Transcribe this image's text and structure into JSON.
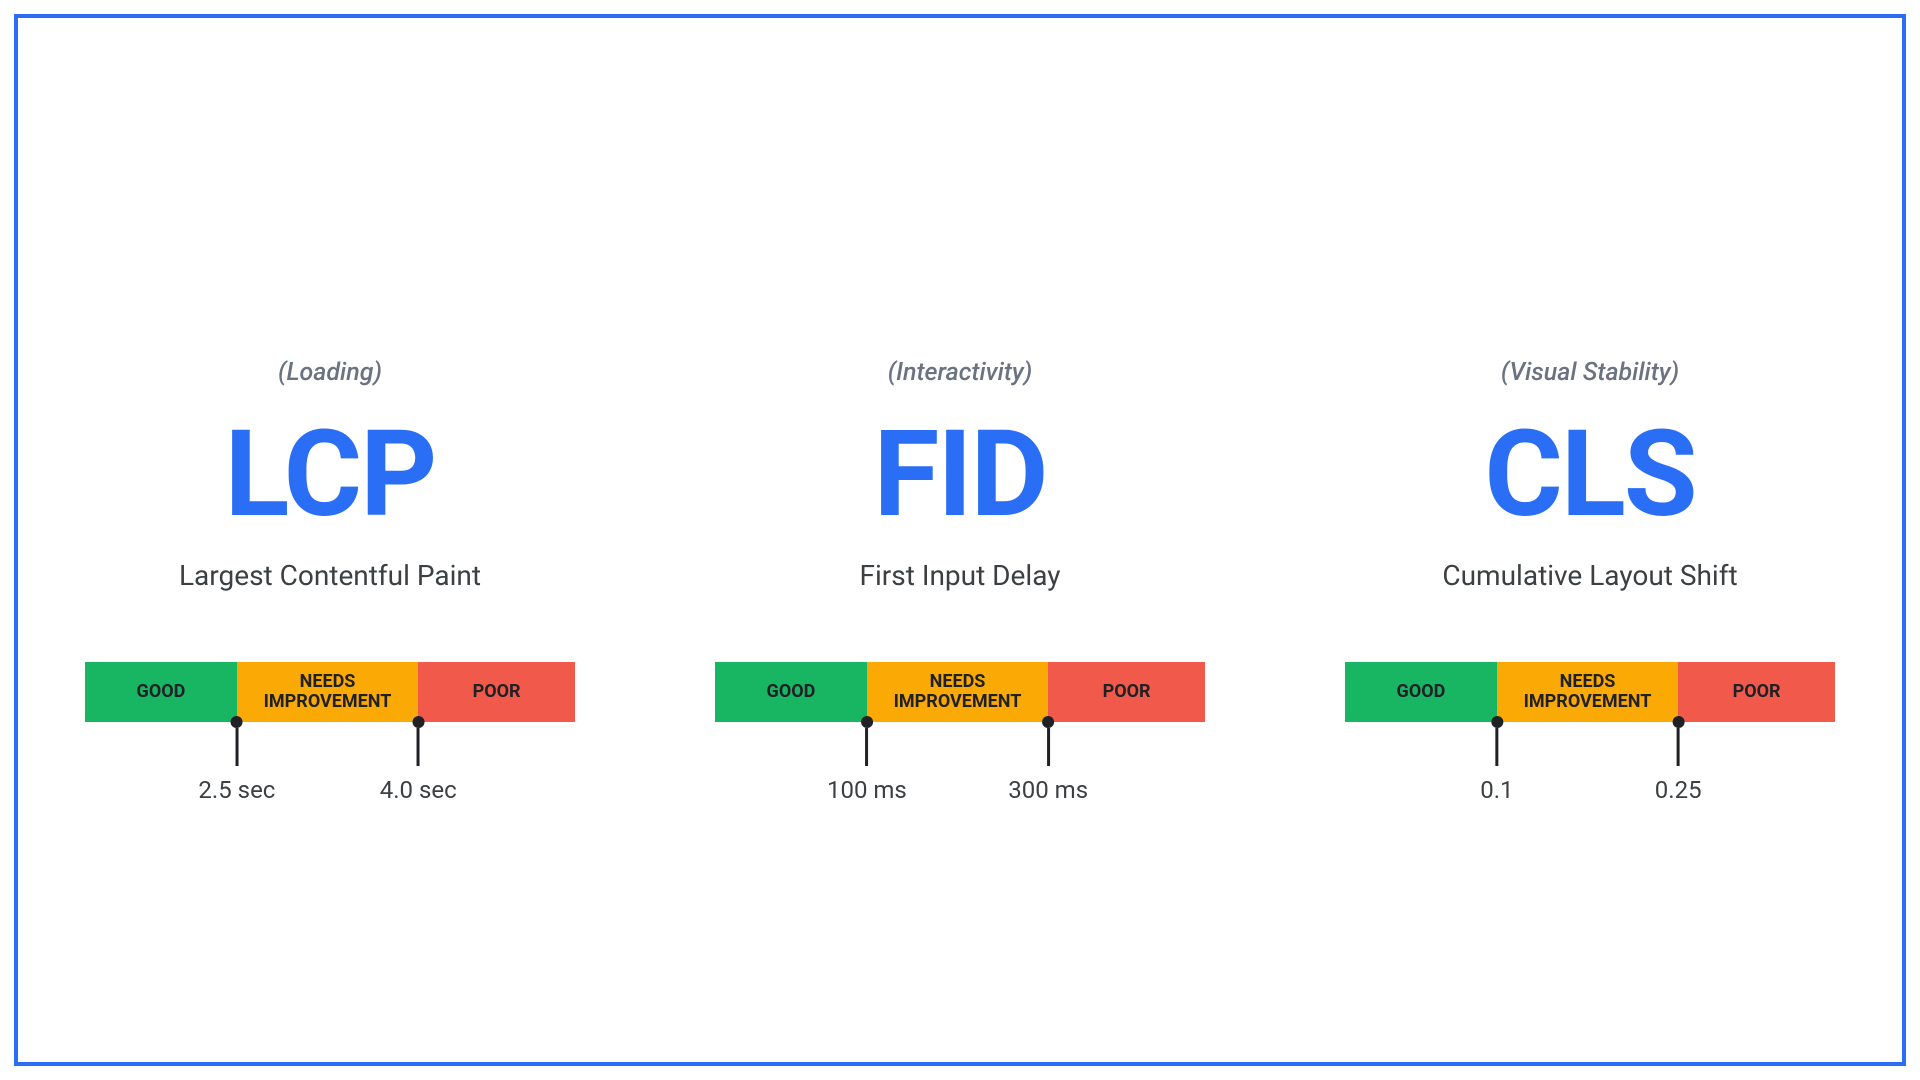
{
  "colors": {
    "accent": "#2a6ef5",
    "good": "#18b663",
    "needs": "#fba904",
    "poor": "#f15a4b",
    "text_muted": "#6b7280",
    "text_body": "#3c4043"
  },
  "segment_labels": {
    "good": "GOOD",
    "needs": "NEEDS\nIMPROVEMENT",
    "poor": "POOR"
  },
  "metrics": [
    {
      "category": "(Loading)",
      "abbrev": "LCP",
      "full_name": "Largest Contentful Paint",
      "threshold1": "2.5 sec",
      "threshold2": "4.0 sec"
    },
    {
      "category": "(Interactivity)",
      "abbrev": "FID",
      "full_name": "First Input Delay",
      "threshold1": "100 ms",
      "threshold2": "300 ms"
    },
    {
      "category": "(Visual Stability)",
      "abbrev": "CLS",
      "full_name": "Cumulative Layout Shift",
      "threshold1": "0.1",
      "threshold2": "0.25"
    }
  ]
}
